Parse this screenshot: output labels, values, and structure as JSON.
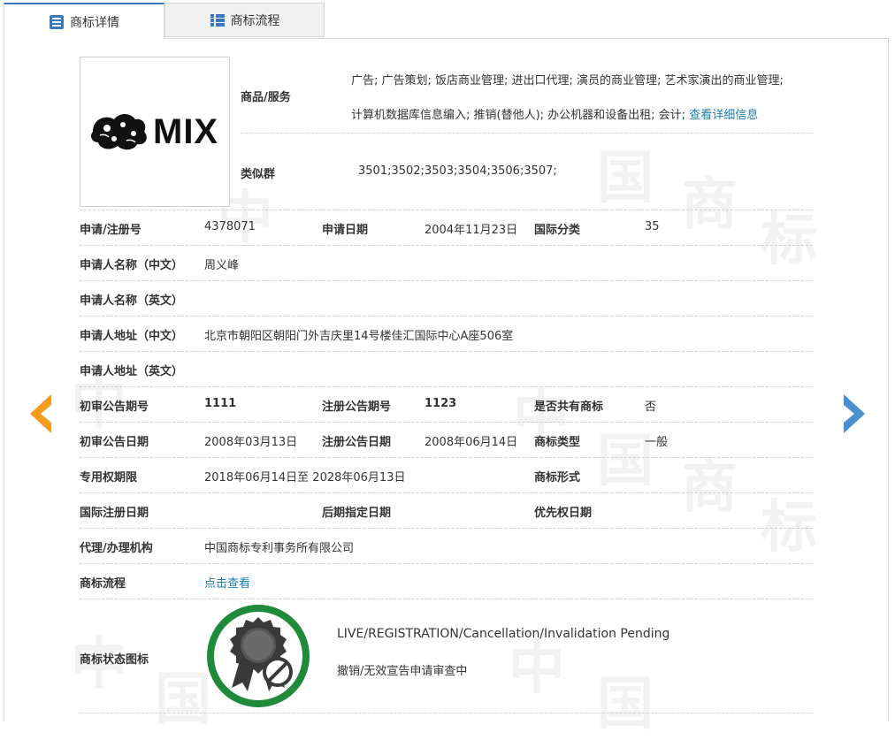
{
  "tabs": [
    {
      "label": "商标详情",
      "icon": "list-detail-icon",
      "active": true
    },
    {
      "label": "商标流程",
      "icon": "grid-list-icon",
      "active": false
    }
  ],
  "watermark": [
    "中",
    "国",
    "商",
    "标"
  ],
  "logo": {
    "text": "MIX",
    "icon": "dragon-mark-icon"
  },
  "goods": {
    "label": "商品/服务",
    "line1": "广告; 广告策划; 饭店商业管理; 进出口代理; 演员的商业管理; 艺术家演出的商业管理;",
    "line2": "计算机数据库信息编入; 推销(替他人); 办公机器和设备出租; 会计;",
    "more_link": "查看详细信息"
  },
  "similar_group": {
    "label": "类似群",
    "value": "3501;3502;3503;3504;3506;3507;"
  },
  "rows": [
    {
      "l1": "申请/注册号",
      "v1": "4378071",
      "l2": "申请日期",
      "v2": "2004年11月23日",
      "l3": "国际分类",
      "v3": "35"
    },
    {
      "l1": "申请人名称（中文）",
      "v1": "周义峰"
    },
    {
      "l1": "申请人名称（英文）",
      "v1": ""
    },
    {
      "l1": "申请人地址（中文）",
      "v1": "北京市朝阳区朝阳门外吉庆里14号楼佳汇国际中心A座506室"
    },
    {
      "l1": "申请人地址（英文）",
      "v1": ""
    },
    {
      "l1": "初审公告期号",
      "v1": "1111",
      "l2": "注册公告期号",
      "v2": "1123",
      "l3": "是否共有商标",
      "v3": "否"
    },
    {
      "l1": "初审公告日期",
      "v1": "2008年03月13日",
      "l2": "注册公告日期",
      "v2": "2008年06月14日",
      "l3": "商标类型",
      "v3": "一般"
    },
    {
      "l1": "专用权期限",
      "v1": "2018年06月14日至 2028年06月13日",
      "l3": "商标形式",
      "v3": ""
    },
    {
      "l1": "国际注册日期",
      "v1": "",
      "l2": "后期指定日期",
      "v2": "",
      "l3": "优先权日期",
      "v3": ""
    },
    {
      "l1": "代理/办理机构",
      "v1": "中国商标专利事务所有限公司"
    },
    {
      "l1": "商标流程",
      "v1": "点击查看"
    }
  ],
  "status": {
    "label": "商标状态图标",
    "en": "LIVE/REGISTRATION/Cancellation/Invalidation Pending",
    "cn": "撤销/无效宣告申请审查中",
    "icon": "award-ribbon-prohibited-icon",
    "ring_color": "#1e8a3a"
  },
  "nav": {
    "prev_icon": "prev-arrow-icon",
    "next_icon": "next-arrow-icon",
    "prev_color": "#f39c1e",
    "next_color": "#4a8fd0"
  }
}
